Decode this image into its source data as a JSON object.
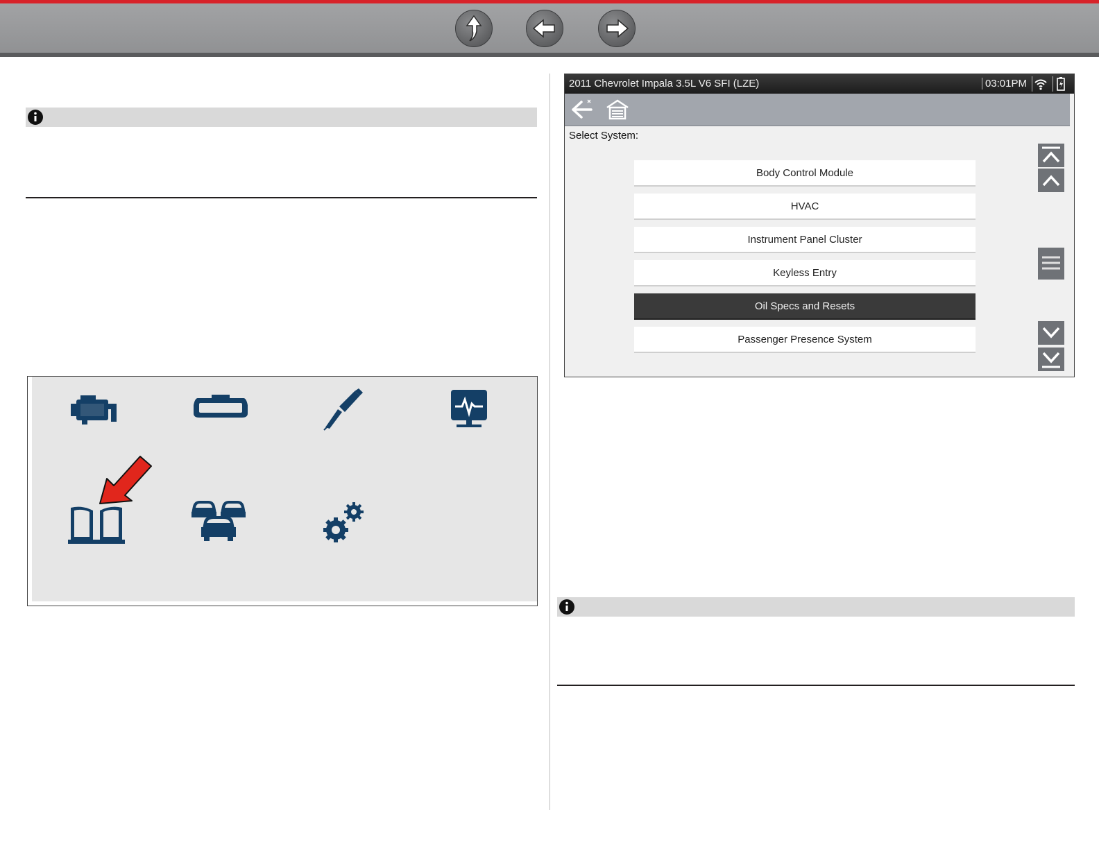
{
  "nav": {
    "buttons": [
      {
        "name": "up-icon"
      },
      {
        "name": "back-arrow-icon"
      },
      {
        "name": "forward-arrow-icon"
      }
    ]
  },
  "colors": {
    "accent_red": "#d8232a",
    "icon_blue": "#143f66",
    "selected_row": "#3a3a3a"
  },
  "icons_panel": {
    "tiles": [
      "engine-icon",
      "mirror-icon",
      "probe-icon",
      "monitor-waveform-icon",
      "book-icon",
      "vehicles-icon",
      "gears-icon"
    ],
    "highlight": "red-pointer-arrow"
  },
  "scanner": {
    "vehicle": "2011 Chevrolet Impala 3.5L V6 SFI (LZE)",
    "time": "03:01PM",
    "select_label": "Select System:",
    "items": [
      {
        "label": "Body Control Module"
      },
      {
        "label": "HVAC"
      },
      {
        "label": "Instrument Panel Cluster"
      },
      {
        "label": "Keyless Entry"
      },
      {
        "label": "Oil Specs and Resets"
      },
      {
        "label": "Passenger Presence System"
      }
    ],
    "selected_index": 4
  }
}
